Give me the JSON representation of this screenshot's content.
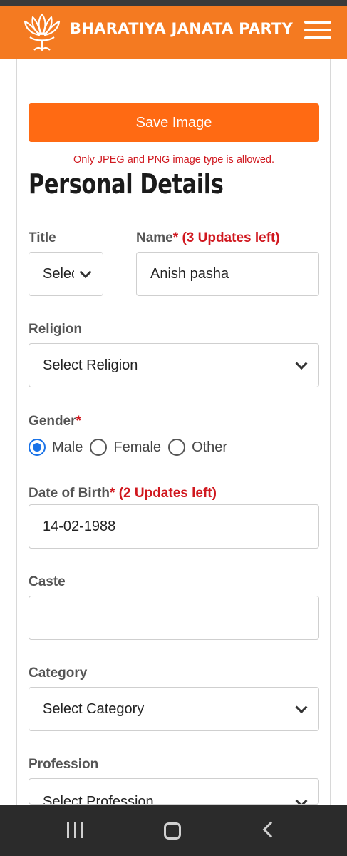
{
  "header": {
    "brand": "BHARATIYA JANATA PARTY",
    "logo_icon": "lotus-logo",
    "menu_icon": "hamburger-menu-icon",
    "bg_color": "#f47a21"
  },
  "upload": {
    "save_label": "Save Image",
    "note": "Only JPEG and PNG image type is allowed."
  },
  "section_title": "Personal Details",
  "form": {
    "title": {
      "label": "Title",
      "value": "Select"
    },
    "name": {
      "label": "Name",
      "required": "*",
      "updates": "(3 Updates left)",
      "value": "Anish pasha"
    },
    "religion": {
      "label": "Religion",
      "value": "Select Religion"
    },
    "gender": {
      "label": "Gender",
      "required": "*",
      "options": [
        "Male",
        "Female",
        "Other"
      ],
      "selected": "Male"
    },
    "dob": {
      "label": "Date of Birth",
      "required": "*",
      "updates": "(2 Updates left)",
      "value": "14-02-1988"
    },
    "caste": {
      "label": "Caste",
      "value": ""
    },
    "category": {
      "label": "Category",
      "value": "Select Category"
    },
    "profession": {
      "label": "Profession",
      "value": "Select Profession"
    }
  },
  "colors": {
    "accent": "#ff6a13",
    "error": "#d0181f",
    "radio": "#1a73e8"
  },
  "navbar": {
    "icons": [
      "recent-apps-icon",
      "home-icon",
      "back-icon"
    ]
  }
}
